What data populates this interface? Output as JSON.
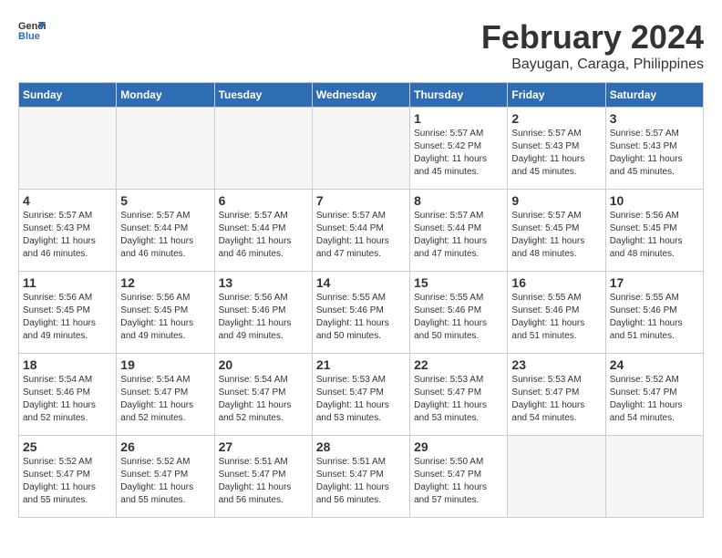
{
  "header": {
    "logo_line1": "General",
    "logo_line2": "Blue",
    "month": "February 2024",
    "location": "Bayugan, Caraga, Philippines"
  },
  "weekdays": [
    "Sunday",
    "Monday",
    "Tuesday",
    "Wednesday",
    "Thursday",
    "Friday",
    "Saturday"
  ],
  "weeks": [
    [
      {
        "day": "",
        "empty": true
      },
      {
        "day": "",
        "empty": true
      },
      {
        "day": "",
        "empty": true
      },
      {
        "day": "",
        "empty": true
      },
      {
        "day": "1",
        "sunrise": "5:57 AM",
        "sunset": "5:42 PM",
        "daylight": "11 hours and 45 minutes."
      },
      {
        "day": "2",
        "sunrise": "5:57 AM",
        "sunset": "5:43 PM",
        "daylight": "11 hours and 45 minutes."
      },
      {
        "day": "3",
        "sunrise": "5:57 AM",
        "sunset": "5:43 PM",
        "daylight": "11 hours and 45 minutes."
      }
    ],
    [
      {
        "day": "4",
        "sunrise": "5:57 AM",
        "sunset": "5:43 PM",
        "daylight": "11 hours and 46 minutes."
      },
      {
        "day": "5",
        "sunrise": "5:57 AM",
        "sunset": "5:44 PM",
        "daylight": "11 hours and 46 minutes."
      },
      {
        "day": "6",
        "sunrise": "5:57 AM",
        "sunset": "5:44 PM",
        "daylight": "11 hours and 46 minutes."
      },
      {
        "day": "7",
        "sunrise": "5:57 AM",
        "sunset": "5:44 PM",
        "daylight": "11 hours and 47 minutes."
      },
      {
        "day": "8",
        "sunrise": "5:57 AM",
        "sunset": "5:44 PM",
        "daylight": "11 hours and 47 minutes."
      },
      {
        "day": "9",
        "sunrise": "5:57 AM",
        "sunset": "5:45 PM",
        "daylight": "11 hours and 48 minutes."
      },
      {
        "day": "10",
        "sunrise": "5:56 AM",
        "sunset": "5:45 PM",
        "daylight": "11 hours and 48 minutes."
      }
    ],
    [
      {
        "day": "11",
        "sunrise": "5:56 AM",
        "sunset": "5:45 PM",
        "daylight": "11 hours and 49 minutes."
      },
      {
        "day": "12",
        "sunrise": "5:56 AM",
        "sunset": "5:45 PM",
        "daylight": "11 hours and 49 minutes."
      },
      {
        "day": "13",
        "sunrise": "5:56 AM",
        "sunset": "5:46 PM",
        "daylight": "11 hours and 49 minutes."
      },
      {
        "day": "14",
        "sunrise": "5:55 AM",
        "sunset": "5:46 PM",
        "daylight": "11 hours and 50 minutes."
      },
      {
        "day": "15",
        "sunrise": "5:55 AM",
        "sunset": "5:46 PM",
        "daylight": "11 hours and 50 minutes."
      },
      {
        "day": "16",
        "sunrise": "5:55 AM",
        "sunset": "5:46 PM",
        "daylight": "11 hours and 51 minutes."
      },
      {
        "day": "17",
        "sunrise": "5:55 AM",
        "sunset": "5:46 PM",
        "daylight": "11 hours and 51 minutes."
      }
    ],
    [
      {
        "day": "18",
        "sunrise": "5:54 AM",
        "sunset": "5:46 PM",
        "daylight": "11 hours and 52 minutes."
      },
      {
        "day": "19",
        "sunrise": "5:54 AM",
        "sunset": "5:47 PM",
        "daylight": "11 hours and 52 minutes."
      },
      {
        "day": "20",
        "sunrise": "5:54 AM",
        "sunset": "5:47 PM",
        "daylight": "11 hours and 52 minutes."
      },
      {
        "day": "21",
        "sunrise": "5:53 AM",
        "sunset": "5:47 PM",
        "daylight": "11 hours and 53 minutes."
      },
      {
        "day": "22",
        "sunrise": "5:53 AM",
        "sunset": "5:47 PM",
        "daylight": "11 hours and 53 minutes."
      },
      {
        "day": "23",
        "sunrise": "5:53 AM",
        "sunset": "5:47 PM",
        "daylight": "11 hours and 54 minutes."
      },
      {
        "day": "24",
        "sunrise": "5:52 AM",
        "sunset": "5:47 PM",
        "daylight": "11 hours and 54 minutes."
      }
    ],
    [
      {
        "day": "25",
        "sunrise": "5:52 AM",
        "sunset": "5:47 PM",
        "daylight": "11 hours and 55 minutes."
      },
      {
        "day": "26",
        "sunrise": "5:52 AM",
        "sunset": "5:47 PM",
        "daylight": "11 hours and 55 minutes."
      },
      {
        "day": "27",
        "sunrise": "5:51 AM",
        "sunset": "5:47 PM",
        "daylight": "11 hours and 56 minutes."
      },
      {
        "day": "28",
        "sunrise": "5:51 AM",
        "sunset": "5:47 PM",
        "daylight": "11 hours and 56 minutes."
      },
      {
        "day": "29",
        "sunrise": "5:50 AM",
        "sunset": "5:47 PM",
        "daylight": "11 hours and 57 minutes."
      },
      {
        "day": "",
        "empty": true
      },
      {
        "day": "",
        "empty": true
      }
    ]
  ],
  "labels": {
    "sunrise": "Sunrise:",
    "sunset": "Sunset:",
    "daylight": "Daylight:"
  }
}
